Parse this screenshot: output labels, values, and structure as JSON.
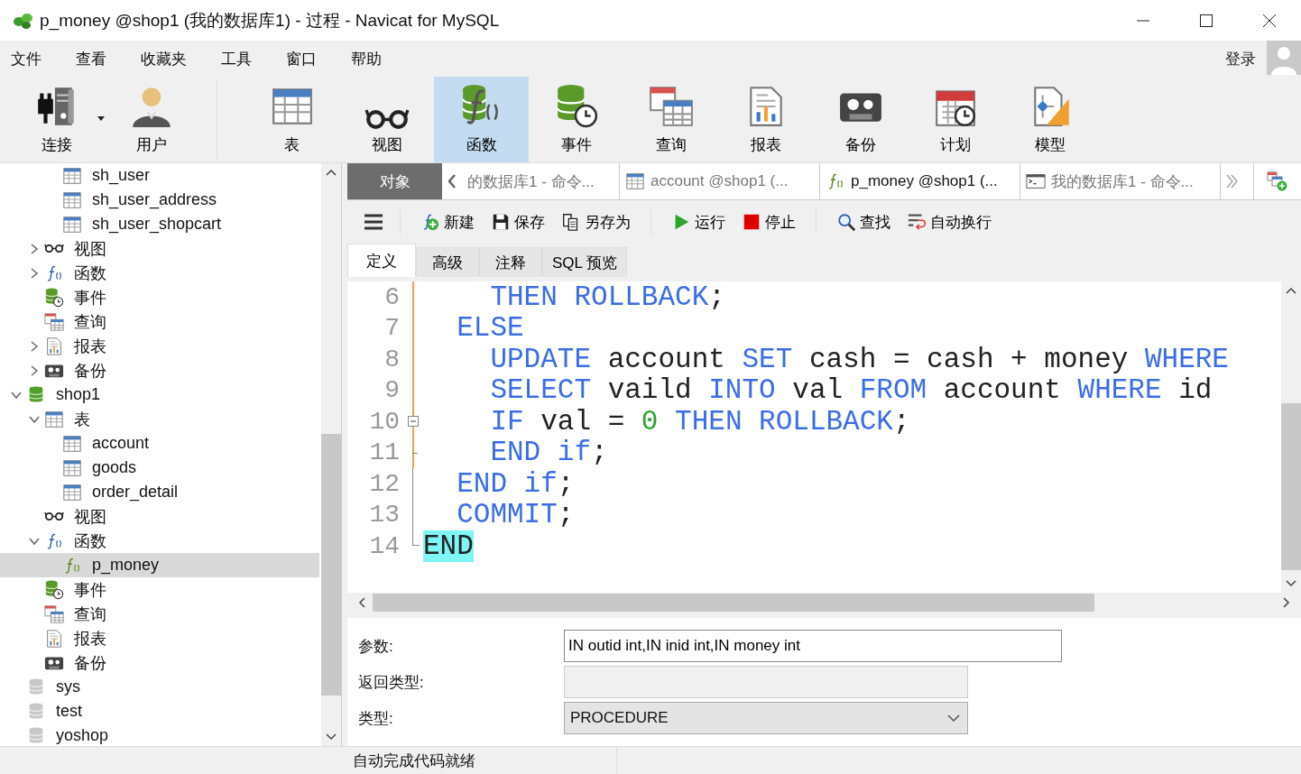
{
  "window": {
    "title": "p_money @shop1 (我的数据库1) - 过程 - Navicat for MySQL"
  },
  "menu": [
    "文件",
    "查看",
    "收藏夹",
    "工具",
    "窗口",
    "帮助"
  ],
  "login": "登录",
  "toolbar": [
    {
      "label": "连接",
      "selected": false,
      "dropdown": true
    },
    {
      "label": "用户",
      "selected": false
    },
    {
      "label": "表",
      "selected": false
    },
    {
      "label": "视图",
      "selected": false
    },
    {
      "label": "函数",
      "selected": true
    },
    {
      "label": "事件",
      "selected": false
    },
    {
      "label": "查询",
      "selected": false
    },
    {
      "label": "报表",
      "selected": false
    },
    {
      "label": "备份",
      "selected": false
    },
    {
      "label": "计划",
      "selected": false
    },
    {
      "label": "模型",
      "selected": false
    }
  ],
  "tree": [
    {
      "children": [
        {
          "children": [
            {
              "label": "sh_user",
              "kind": "table",
              "selected": false
            },
            {
              "label": "sh_user_address",
              "kind": "table",
              "selected": false
            },
            {
              "label": "sh_user_shopcart",
              "kind": "table",
              "selected": false
            }
          ]
        },
        {
          "label": "视图",
          "kind": "view",
          "expanded": false,
          "selected": false
        },
        {
          "label": "函数",
          "kind": "func",
          "expanded": false,
          "selected": false
        },
        {
          "label": "事件",
          "kind": "event",
          "selected": false
        },
        {
          "label": "查询",
          "kind": "query",
          "selected": false
        },
        {
          "label": "报表",
          "kind": "report",
          "expanded": false,
          "selected": false
        },
        {
          "label": "备份",
          "kind": "backup",
          "expanded": false,
          "selected": false
        }
      ]
    },
    {
      "label": "shop1",
      "kind": "db",
      "expanded": true,
      "selected": false,
      "children": [
        {
          "label": "表",
          "kind": "table",
          "expanded": true,
          "selected": false,
          "children": [
            {
              "label": "account",
              "kind": "table",
              "selected": false
            },
            {
              "label": "goods",
              "kind": "table",
              "selected": false
            },
            {
              "label": "order_detail",
              "kind": "table",
              "selected": false
            }
          ]
        },
        {
          "label": "视图",
          "kind": "view",
          "selected": false
        },
        {
          "label": "函数",
          "kind": "func",
          "expanded": true,
          "selected": false,
          "children": [
            {
              "label": "p_money",
              "kind": "proc",
              "selected": true
            }
          ]
        },
        {
          "label": "事件",
          "kind": "event",
          "selected": false
        },
        {
          "label": "查询",
          "kind": "query",
          "selected": false
        },
        {
          "label": "报表",
          "kind": "report",
          "selected": false
        },
        {
          "label": "备份",
          "kind": "backup",
          "selected": false
        }
      ]
    },
    {
      "label": "sys",
      "kind": "dboff",
      "selected": false
    },
    {
      "label": "test",
      "kind": "dboff",
      "selected": false
    },
    {
      "label": "yoshop",
      "kind": "dboff",
      "selected": false
    }
  ],
  "objects_tab": "对象",
  "doc_tabs": [
    {
      "label": "的数据库1 - 命令...",
      "kind": "plain",
      "selected": false
    },
    {
      "label": "account @shop1 (...",
      "kind": "table",
      "selected": false
    },
    {
      "label": "p_money @shop1 (...",
      "kind": "proc",
      "selected": true
    },
    {
      "label": "我的数据库1 - 命令...",
      "kind": "cmd",
      "selected": false
    }
  ],
  "editor_toolbar": [
    {
      "label": "新建"
    },
    {
      "label": "保存"
    },
    {
      "label": "另存为"
    },
    {
      "label": "运行"
    },
    {
      "label": "停止"
    },
    {
      "label": "查找"
    },
    {
      "label": "自动换行"
    }
  ],
  "sub_tabs": [
    {
      "label": "定义",
      "selected": true
    },
    {
      "label": "高级",
      "selected": false
    },
    {
      "label": "注释",
      "selected": false
    },
    {
      "label": "SQL 预览",
      "selected": false
    }
  ],
  "code": [
    {
      "number": "6",
      "kind": "bar",
      "tokens": [
        {
          "kind": "kw",
          "text": "    THEN"
        },
        {
          "kind": "kw",
          "text": " ROLLBACK"
        },
        {
          "kind": "op",
          "text": ";"
        }
      ]
    },
    {
      "number": "7",
      "kind": "bar",
      "tokens": [
        {
          "kind": "kw",
          "text": "  ELSE"
        }
      ]
    },
    {
      "number": "8",
      "kind": "bar",
      "tokens": [
        {
          "kind": "kw",
          "text": "    UPDATE"
        },
        {
          "kind": "id",
          "text": " account"
        },
        {
          "kind": "kw",
          "text": " SET"
        },
        {
          "kind": "id",
          "text": " cash = cash + money"
        },
        {
          "kind": "kw",
          "text": " WHERE"
        }
      ]
    },
    {
      "number": "9",
      "kind": "bar",
      "tokens": [
        {
          "kind": "kw",
          "text": "    SELECT"
        },
        {
          "kind": "id",
          "text": " vaild"
        },
        {
          "kind": "kw",
          "text": " INTO"
        },
        {
          "kind": "id",
          "text": " val"
        },
        {
          "kind": "kw",
          "text": " FROM"
        },
        {
          "kind": "id",
          "text": " account"
        },
        {
          "kind": "kw",
          "text": " WHERE"
        },
        {
          "kind": "id",
          "text": " id"
        }
      ]
    },
    {
      "number": "10",
      "kind": "box",
      "tokens": [
        {
          "kind": "kw",
          "text": "    IF"
        },
        {
          "kind": "id",
          "text": " val ="
        },
        {
          "kind": "num",
          "text": " 0"
        },
        {
          "kind": "kw",
          "text": " THEN ROLLBACK"
        },
        {
          "kind": "op",
          "text": ";"
        }
      ]
    },
    {
      "number": "11",
      "kind": "tick",
      "tokens": [
        {
          "kind": "kw",
          "text": "    END if"
        },
        {
          "kind": "op",
          "text": ";"
        }
      ]
    },
    {
      "number": "12",
      "kind": "line",
      "tokens": [
        {
          "kind": "kw",
          "text": "  END if"
        },
        {
          "kind": "op",
          "text": ";"
        }
      ]
    },
    {
      "number": "13",
      "kind": "line",
      "tokens": [
        {
          "kind": "kw",
          "text": "  COMMIT"
        },
        {
          "kind": "op",
          "text": ";"
        }
      ]
    },
    {
      "number": "14",
      "kind": "end",
      "tokens": [
        {
          "kind": "match",
          "text": "END"
        }
      ]
    }
  ],
  "form": [
    {
      "label": "参数:",
      "kind": "text",
      "value": "IN outid int,IN inid int,IN money int"
    },
    {
      "label": "返回类型:",
      "kind": "disabled"
    },
    {
      "label": "类型:",
      "kind": "select",
      "value": "PROCEDURE"
    }
  ],
  "status_bar": "自动完成代码就绪"
}
